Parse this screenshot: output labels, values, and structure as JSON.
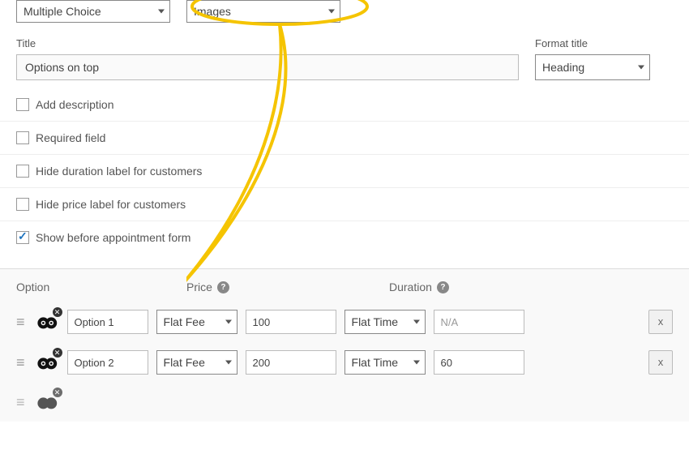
{
  "topSelects": {
    "type": "Multiple Choice",
    "format": "Images"
  },
  "title": {
    "label": "Title",
    "value": "Options on top"
  },
  "formatTitle": {
    "label": "Format title",
    "value": "Heading"
  },
  "checkboxes": {
    "addDescription": "Add description",
    "requiredField": "Required field",
    "hideDuration": "Hide duration label for customers",
    "hidePrice": "Hide price label for customers",
    "showBefore": "Show before appointment form"
  },
  "headers": {
    "option": "Option",
    "price": "Price",
    "duration": "Duration"
  },
  "rows": [
    {
      "name": "Option 1",
      "priceType": "Flat Fee",
      "priceAmount": "100",
      "durationType": "Flat Time",
      "durationAmount": "",
      "durationPlaceholder": "N/A"
    },
    {
      "name": "Option 2",
      "priceType": "Flat Fee",
      "priceAmount": "200",
      "durationType": "Flat Time",
      "durationAmount": "60",
      "durationPlaceholder": ""
    }
  ],
  "deleteLabel": "x"
}
